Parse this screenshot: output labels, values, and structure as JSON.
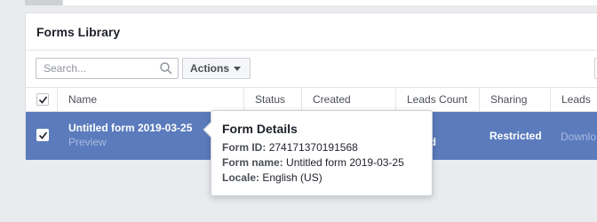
{
  "panel": {
    "title": "Forms Library"
  },
  "toolbar": {
    "search_placeholder": "Search...",
    "search_value": "",
    "actions_label": "Actions"
  },
  "table": {
    "columns": [
      "Name",
      "Status",
      "Created",
      "Leads Count",
      "Sharing",
      "Leads"
    ],
    "row": {
      "name": "Untitled form 2019-03-25",
      "preview_label": "Preview",
      "status": "ired",
      "sharing": "Restricted",
      "leads_link": "Downlo"
    }
  },
  "tooltip": {
    "title": "Form Details",
    "form_id_label": "Form ID:",
    "form_id": "274171370191568",
    "form_name_label": "Form name:",
    "form_name": "Untitled form 2019-03-25",
    "locale_label": "Locale:",
    "locale": "English (US)"
  },
  "colors": {
    "selected_row": "#5b7bbd",
    "background": "#e9ebee"
  }
}
